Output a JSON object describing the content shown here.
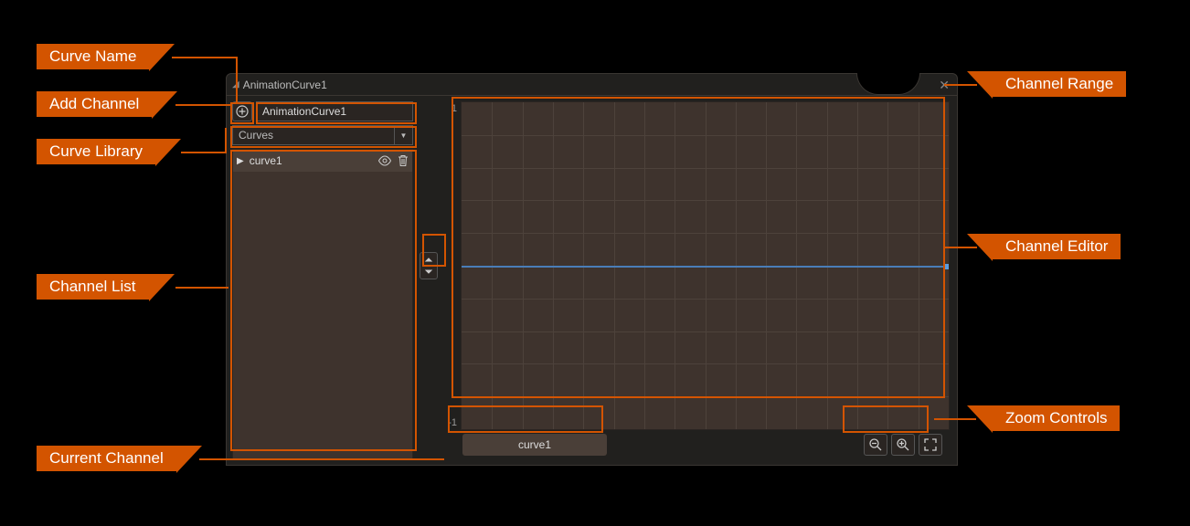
{
  "labels": {
    "curve_name": "Curve Name",
    "add_channel": "Add Channel",
    "curve_library": "Curve Library",
    "channel_list": "Channel List",
    "current_channel": "Current Channel",
    "channel_range": "Channel Range",
    "channel_editor": "Channel Editor",
    "zoom_controls": "Zoom Controls"
  },
  "window": {
    "title": "AnimationCurve1"
  },
  "sidebar": {
    "curve_name_value": "AnimationCurve1",
    "library_selected": "Curves",
    "channels": [
      {
        "name": "curve1"
      }
    ]
  },
  "editor": {
    "y_max": "1",
    "y_min": "-1"
  },
  "bottom": {
    "current_channel": "curve1"
  }
}
